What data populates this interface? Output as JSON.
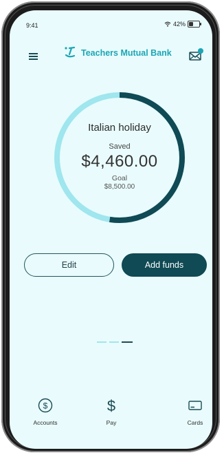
{
  "status_bar": {
    "time": "9:41",
    "battery": "42%",
    "battery_level": 0.42
  },
  "header": {
    "brand": "Teachers Mutual Bank"
  },
  "goal": {
    "title": "Italian holiday",
    "saved_label": "Saved",
    "saved_amount": "$4,460.00",
    "goal_label": "Goal",
    "goal_amount": "$8,500.00",
    "progress": 0.525
  },
  "actions": {
    "edit_label": "Edit",
    "add_label": "Add funds"
  },
  "pager": {
    "count": 3,
    "active": 2
  },
  "tabbar": {
    "accounts": "Accounts",
    "pay": "Pay",
    "cards": "Cards"
  },
  "colors": {
    "accent": "#1ba6b6",
    "dark": "#0f4a55",
    "ring_track": "#9fe6ee",
    "background": "#e9fbfc"
  }
}
